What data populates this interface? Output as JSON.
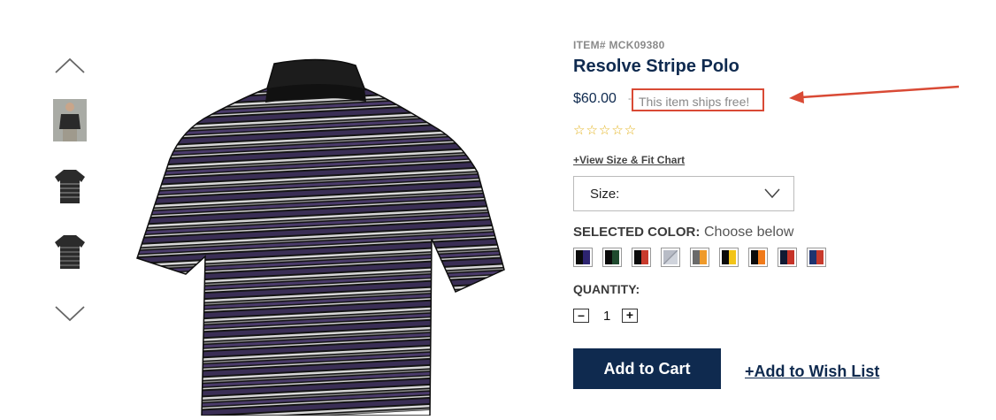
{
  "rail": {
    "up_icon": "chevron-up-icon",
    "down_icon": "chevron-down-icon",
    "thumbnails": [
      "model-wearing-polo",
      "polo-front",
      "polo-back"
    ]
  },
  "product": {
    "item_number": "ITEM# MCK09380",
    "name": "Resolve Stripe Polo",
    "price": "$60.00",
    "price_separator": "-",
    "shipping_note": "This item ships free!",
    "rating": "☆☆☆☆☆",
    "rating_value": 0,
    "size_chart_link": "+View Size & Fit Chart",
    "size_select": {
      "label": "Size:"
    },
    "selected_color_label": "SELECTED COLOR:",
    "selected_color_value": "Choose below",
    "color_swatches": [
      [
        "#0b0b0b",
        "#2d2470"
      ],
      [
        "#0b0b0b",
        "#1f4a2e"
      ],
      [
        "#0b0b0b",
        "#c83a2c"
      ],
      [
        "#b8bcc6",
        "#d0d4dc"
      ],
      [
        "#6a6a6a",
        "#ef9a2a"
      ],
      [
        "#0b0b0b",
        "#f2c418"
      ],
      [
        "#0b0b0b",
        "#f07a1a"
      ],
      [
        "#111a33",
        "#c63328"
      ],
      [
        "#1f3470",
        "#c83a2c"
      ]
    ],
    "quantity_label": "QUANTITY:",
    "quantity_minus": "–",
    "quantity_value": "1",
    "quantity_plus": "+",
    "add_to_cart": "Add to Cart",
    "wishlist": "+Add to Wish List"
  },
  "colors": {
    "brand_navy": "#0f2a4f",
    "annotation_red": "#d94a35",
    "star_gold": "#e3b21c"
  }
}
